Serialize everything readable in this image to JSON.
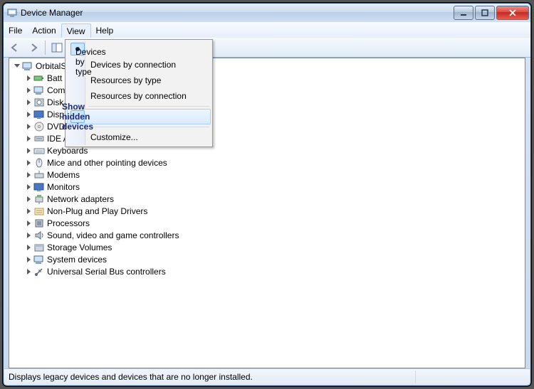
{
  "window": {
    "title": "Device Manager"
  },
  "menubar": {
    "items": [
      "File",
      "Action",
      "View",
      "Help"
    ],
    "open_index": 2
  },
  "dropdown": {
    "group1": [
      {
        "label": "Devices by type",
        "marker": "radio"
      },
      {
        "label": "Devices by connection",
        "marker": ""
      },
      {
        "label": "Resources by type",
        "marker": ""
      },
      {
        "label": "Resources by connection",
        "marker": ""
      }
    ],
    "group2": [
      {
        "label": "Show hidden devices",
        "marker": "check",
        "hover": true
      }
    ],
    "group3": [
      {
        "label": "Customize...",
        "marker": ""
      }
    ]
  },
  "tree": {
    "root": {
      "label": "OrbitalS",
      "icon": "computer",
      "cut": true
    },
    "children": [
      {
        "label": "Batt",
        "icon": "battery",
        "cut": true
      },
      {
        "label": "Com",
        "icon": "computer",
        "cut": true
      },
      {
        "label": "Disk",
        "icon": "disk",
        "cut": true
      },
      {
        "label": "Disp",
        "icon": "display",
        "cut": true
      },
      {
        "label": "DVD",
        "icon": "dvd",
        "cut": true
      },
      {
        "label": "IDE A",
        "icon": "ide",
        "cut": true
      },
      {
        "label": "Keyboards",
        "icon": "keyboard"
      },
      {
        "label": "Mice and other pointing devices",
        "icon": "mouse"
      },
      {
        "label": "Modems",
        "icon": "modem"
      },
      {
        "label": "Monitors",
        "icon": "monitor"
      },
      {
        "label": "Network adapters",
        "icon": "network"
      },
      {
        "label": "Non-Plug and Play Drivers",
        "icon": "legacy"
      },
      {
        "label": "Processors",
        "icon": "cpu"
      },
      {
        "label": "Sound, video and game controllers",
        "icon": "sound"
      },
      {
        "label": "Storage Volumes",
        "icon": "storage"
      },
      {
        "label": "System devices",
        "icon": "system"
      },
      {
        "label": "Universal Serial Bus controllers",
        "icon": "usb"
      }
    ]
  },
  "statusbar": {
    "text": "Displays legacy devices and devices that are no longer installed."
  }
}
